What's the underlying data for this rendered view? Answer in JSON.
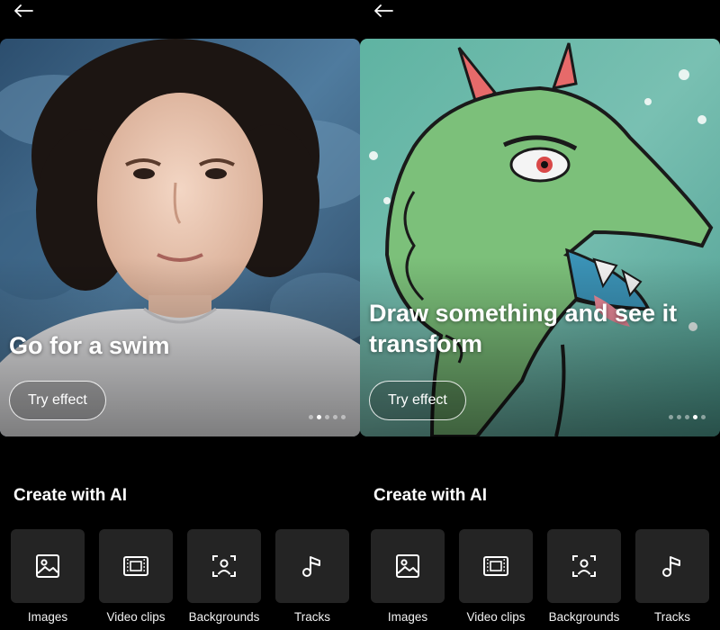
{
  "panels": [
    {
      "id": "left",
      "card": {
        "title": "Go for a swim",
        "button_label": "Try effect",
        "carousel_total": 5,
        "carousel_active": 1
      },
      "section_title": "Create with AI",
      "tiles": [
        {
          "label": "Images",
          "icon": "image-icon"
        },
        {
          "label": "Video clips",
          "icon": "film-icon"
        },
        {
          "label": "Backgrounds",
          "icon": "person-frame-icon"
        },
        {
          "label": "Tracks",
          "icon": "music-note-icon"
        }
      ]
    },
    {
      "id": "right",
      "card": {
        "title": "Draw something and see it transform",
        "button_label": "Try effect",
        "carousel_total": 5,
        "carousel_active": 3
      },
      "section_title": "Create with AI",
      "tiles": [
        {
          "label": "Images",
          "icon": "image-icon"
        },
        {
          "label": "Video clips",
          "icon": "film-icon"
        },
        {
          "label": "Backgrounds",
          "icon": "person-frame-icon"
        },
        {
          "label": "Tracks",
          "icon": "music-note-icon"
        }
      ]
    }
  ],
  "colors": {
    "background": "#000000",
    "tile_background": "#242424",
    "text": "#ffffff"
  }
}
